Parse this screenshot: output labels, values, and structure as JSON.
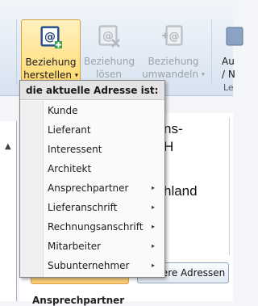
{
  "ribbon": {
    "beziehung_herstellen": {
      "line1": "Beziehung",
      "line2": "herstellen",
      "caret": "▾",
      "icon": "address-card-at-icon"
    },
    "beziehung_loesen": {
      "line1": "Beziehung",
      "line2": "lösen",
      "icon": "address-card-remove-icon"
    },
    "beziehung_umwandeln": {
      "line1": "Beziehung",
      "line2": "umwandeln",
      "caret": "▾",
      "icon": "address-card-convert-icon"
    },
    "partial_button": {
      "line1": "Au",
      "line2": "/ N"
    },
    "partial_group_label": "Le"
  },
  "background": {
    "card_line1": "ns-",
    "card_line2": "H",
    "card_line3": "hland",
    "addresses_button": "itere Adressen",
    "section_label": "Ansprechpartner"
  },
  "menu": {
    "header": "die aktuelle Adresse ist:",
    "items": [
      {
        "label": "Kunde",
        "submenu": false
      },
      {
        "label": "Lieferant",
        "submenu": false
      },
      {
        "label": "Interessent",
        "submenu": false
      },
      {
        "label": "Architekt",
        "submenu": false
      },
      {
        "label": "Ansprechpartner",
        "submenu": true
      },
      {
        "label": "Lieferanschrift",
        "submenu": true
      },
      {
        "label": "Rechnungsanschrift",
        "submenu": true
      },
      {
        "label": "Mitarbeiter",
        "submenu": true
      },
      {
        "label": "Subunternehmer",
        "submenu": true
      }
    ],
    "submenu_arrow": "▸"
  },
  "colors": {
    "ribbon_bg": "#dfe8f3",
    "active_button": "#ffd86c",
    "menu_bg": "#fafafa",
    "menu_header_bg": "#e4e4e4",
    "disabled_text": "#9aa3ad"
  }
}
